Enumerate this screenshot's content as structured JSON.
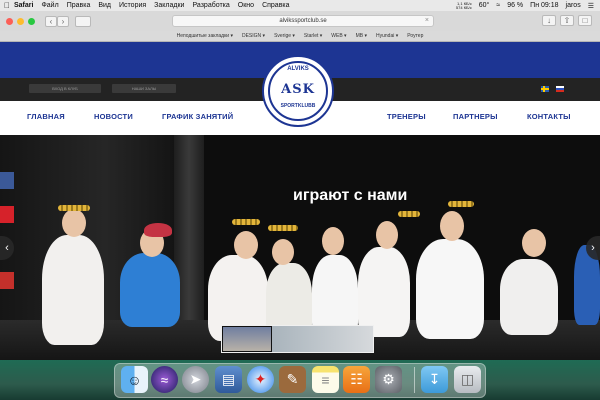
{
  "menubar": {
    "apple": "",
    "app": "Safari",
    "items": [
      "Файл",
      "Правка",
      "Вид",
      "История",
      "Закладки",
      "Разработка",
      "Окно",
      "Справка"
    ],
    "net_up": "1,1 КБ/с",
    "net_down": "574 КБ/с",
    "battery_pct": "60°",
    "battery_label": "96 %",
    "time": "Пн 09:18",
    "user": "jaros"
  },
  "browser": {
    "url": "alvikssportclub.se",
    "favorites": [
      "Неподшитые закладки ▾",
      "DESIGN ▾",
      "Sverige ▾",
      "Starlet ▾",
      "WEB ▾",
      "MB ▾",
      "Hyundai ▾",
      "Роутер"
    ]
  },
  "site": {
    "top_buttons": [
      "ВХОД В КЛУБ",
      "НАШИ ЗАЛЫ"
    ],
    "logo_top": "ALVIKS",
    "logo_mid": "ASK",
    "logo_bottom": "SPORTKLUBB",
    "nav": [
      "ГЛАВНАЯ",
      "НОВОСТИ",
      "ГРАФИК ЗАНЯТИЙ",
      "ТРЕНЕРЫ",
      "ПАРТНЕРЫ",
      "КОНТАКТЫ"
    ],
    "hero_title": "играют с нами",
    "brand_color": "#1d3593"
  },
  "dock": {
    "icons": [
      "finder-icon",
      "siri-icon",
      "launchpad-icon",
      "preview-icon",
      "safari-icon",
      "notefile-icon",
      "notes-icon",
      "books-icon",
      "system-preferences-icon",
      "downloads-folder-icon",
      "trash-icon"
    ]
  }
}
